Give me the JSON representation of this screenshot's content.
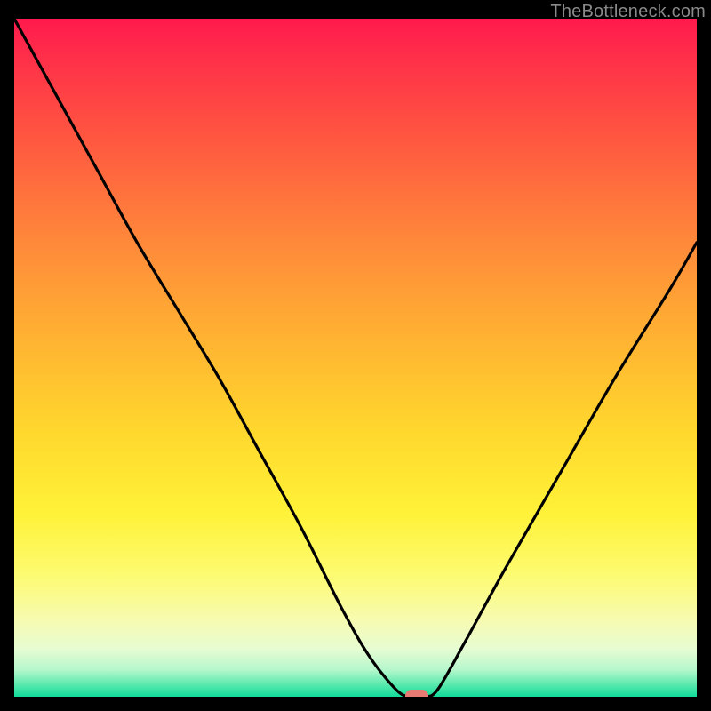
{
  "watermark": "TheBottleneck.com",
  "colors": {
    "frame": "#000000",
    "curve_stroke": "#000000",
    "marker": "#e77a72"
  },
  "chart_data": {
    "type": "line",
    "title": "",
    "xlabel": "",
    "ylabel": "",
    "xlim": [
      0,
      100
    ],
    "ylim": [
      0,
      100
    ],
    "series": [
      {
        "name": "bottleneck-curve",
        "x": [
          0,
          6,
          12,
          18,
          24,
          30,
          36,
          42,
          48,
          52,
          56,
          58,
          60,
          62,
          66,
          72,
          80,
          88,
          96,
          100
        ],
        "values": [
          100,
          89,
          78,
          67,
          57,
          47,
          36,
          25,
          13,
          6,
          1,
          0,
          0,
          1,
          8,
          19,
          33,
          47,
          60,
          67
        ]
      }
    ],
    "marker": {
      "x": 59,
      "y": 0,
      "w": 3.3,
      "h": 2.2
    },
    "annotations": []
  }
}
